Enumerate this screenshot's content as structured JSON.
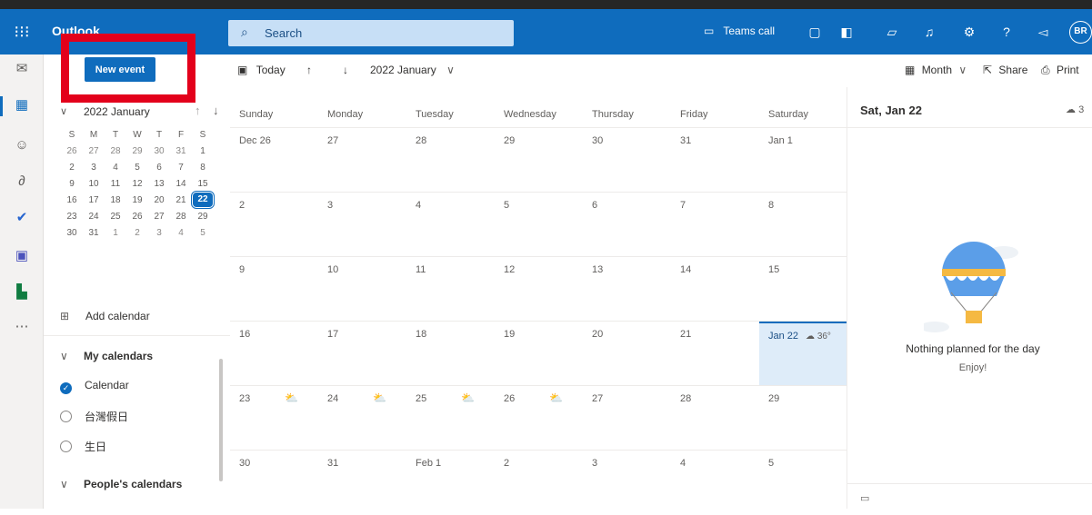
{
  "app": {
    "title": "Outlook",
    "avatar_initials": "BR"
  },
  "search": {
    "placeholder": "Search"
  },
  "topbar": {
    "teams_call_label": "Teams call"
  },
  "left": {
    "new_event_label": "New event",
    "mini_calendar": {
      "title": "2022 January",
      "weekdays": [
        "S",
        "M",
        "T",
        "W",
        "T",
        "F",
        "S"
      ],
      "weeks": [
        [
          "26",
          "27",
          "28",
          "29",
          "30",
          "31",
          "1"
        ],
        [
          "2",
          "3",
          "4",
          "5",
          "6",
          "7",
          "8"
        ],
        [
          "9",
          "10",
          "11",
          "12",
          "13",
          "14",
          "15"
        ],
        [
          "16",
          "17",
          "18",
          "19",
          "20",
          "21",
          "22"
        ],
        [
          "23",
          "24",
          "25",
          "26",
          "27",
          "28",
          "29"
        ],
        [
          "30",
          "31",
          "1",
          "2",
          "3",
          "4",
          "5"
        ]
      ],
      "today": "22"
    },
    "add_calendar_label": "Add calendar",
    "my_calendars_label": "My calendars",
    "calendars": [
      {
        "label": "Calendar",
        "checked": true
      },
      {
        "label": "台灣假日",
        "checked": false
      },
      {
        "label": "生日",
        "checked": false
      }
    ],
    "peoples_calendars_label": "People's calendars"
  },
  "toolbar": {
    "today_label": "Today",
    "month_title": "2022 January",
    "view_label": "Month",
    "share_label": "Share",
    "print_label": "Print"
  },
  "month": {
    "days": [
      "Sunday",
      "Monday",
      "Tuesday",
      "Wednesday",
      "Thursday",
      "Friday",
      "Saturday"
    ],
    "weeks": [
      [
        "Dec 26",
        "27",
        "28",
        "29",
        "30",
        "31",
        "Jan 1"
      ],
      [
        "2",
        "3",
        "4",
        "5",
        "6",
        "7",
        "8"
      ],
      [
        "9",
        "10",
        "11",
        "12",
        "13",
        "14",
        "15"
      ],
      [
        "16",
        "17",
        "18",
        "19",
        "20",
        "21",
        "Jan 22"
      ],
      [
        "23",
        "24",
        "25",
        "26",
        "27",
        "28",
        "29"
      ],
      [
        "30",
        "31",
        "Feb 1",
        "2",
        "3",
        "4",
        "5"
      ]
    ],
    "today_weather": "36°"
  },
  "right": {
    "date_label": "Sat, Jan 22",
    "weather": "3",
    "nothing_planned": "Nothing planned for the day",
    "enjoy": "Enjoy!"
  },
  "colors": {
    "brand": "#0f6cbd",
    "highlight_box": "#e3001b",
    "today_cell": "#deecf9"
  }
}
